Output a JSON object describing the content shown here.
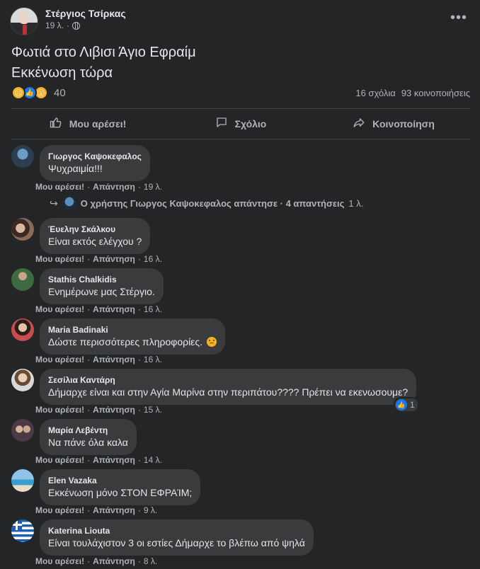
{
  "post": {
    "author": "Στέργιος Τσίρκας",
    "time": "19 λ.",
    "separator": "·",
    "text_line1": "Φωτιά στο Λιβισι Άγιο Εφραίμ",
    "text_line2": "Εκκένωση τώρα",
    "reaction_count": "40",
    "comments_count": "16 σχόλια",
    "shares_count": "93 κοινοποιήσεις",
    "reactions": [
      "sad",
      "like",
      "wow"
    ]
  },
  "actions": {
    "like": "Μου αρέσει!",
    "comment": "Σχόλιο",
    "share": "Κοινοποίηση"
  },
  "comment_actions": {
    "like": "Μου αρέσει!",
    "reply": "Απάντηση",
    "dot": "·"
  },
  "comments": [
    {
      "name": "Γιωργος Καψοκεφαλος",
      "text": "Ψυχραιμία!!!",
      "time": "19 λ."
    },
    {
      "name": "Έυελην Σκάλκου",
      "text": "Είναι εκτός ελέγχου ?",
      "time": "16 λ."
    },
    {
      "name": "Stathis Chalkidis",
      "text": "Ενημέρωνε μας Στέργιο.",
      "time": "16 λ."
    },
    {
      "name": "Maria Badinaki",
      "text": "Δώστε περισσότερες πληροφορίες.",
      "time": "16 λ."
    },
    {
      "name": "Σεσίλια Καντάρη",
      "text": "Δήμαρχε είναι και στην Αγία Μαρίνα στην περιπάτου???? Πρέπει να εκενωσουμε?",
      "time": "15 λ.",
      "likes": "1"
    },
    {
      "name": "Μαρία Λεβέντη",
      "text": "Να πάνε όλα καλα",
      "time": "14 λ."
    },
    {
      "name": "Elen Vazaka",
      "text": "Εκκένωση μόνο ΣΤΟΝ ΕΦΡΑΊΜ;",
      "time": "9 λ."
    },
    {
      "name": "Katerina Liouta",
      "text": "Είναι τουλάχιστον 3 οι εστίες Δήμαρχε το βλέπω από ψηλά",
      "time": "8 λ."
    }
  ],
  "replies": {
    "text": "Ο χρήστης Γιωργος Καψοκεφαλος απάντησε · 4 απαντήσεις",
    "time": "1 λ."
  },
  "colors": {
    "background": "#242526",
    "bubble": "#3a3b3c",
    "text": "#e4e6eb",
    "secondary": "#b0b3b8",
    "like_blue": "#1877f2"
  }
}
